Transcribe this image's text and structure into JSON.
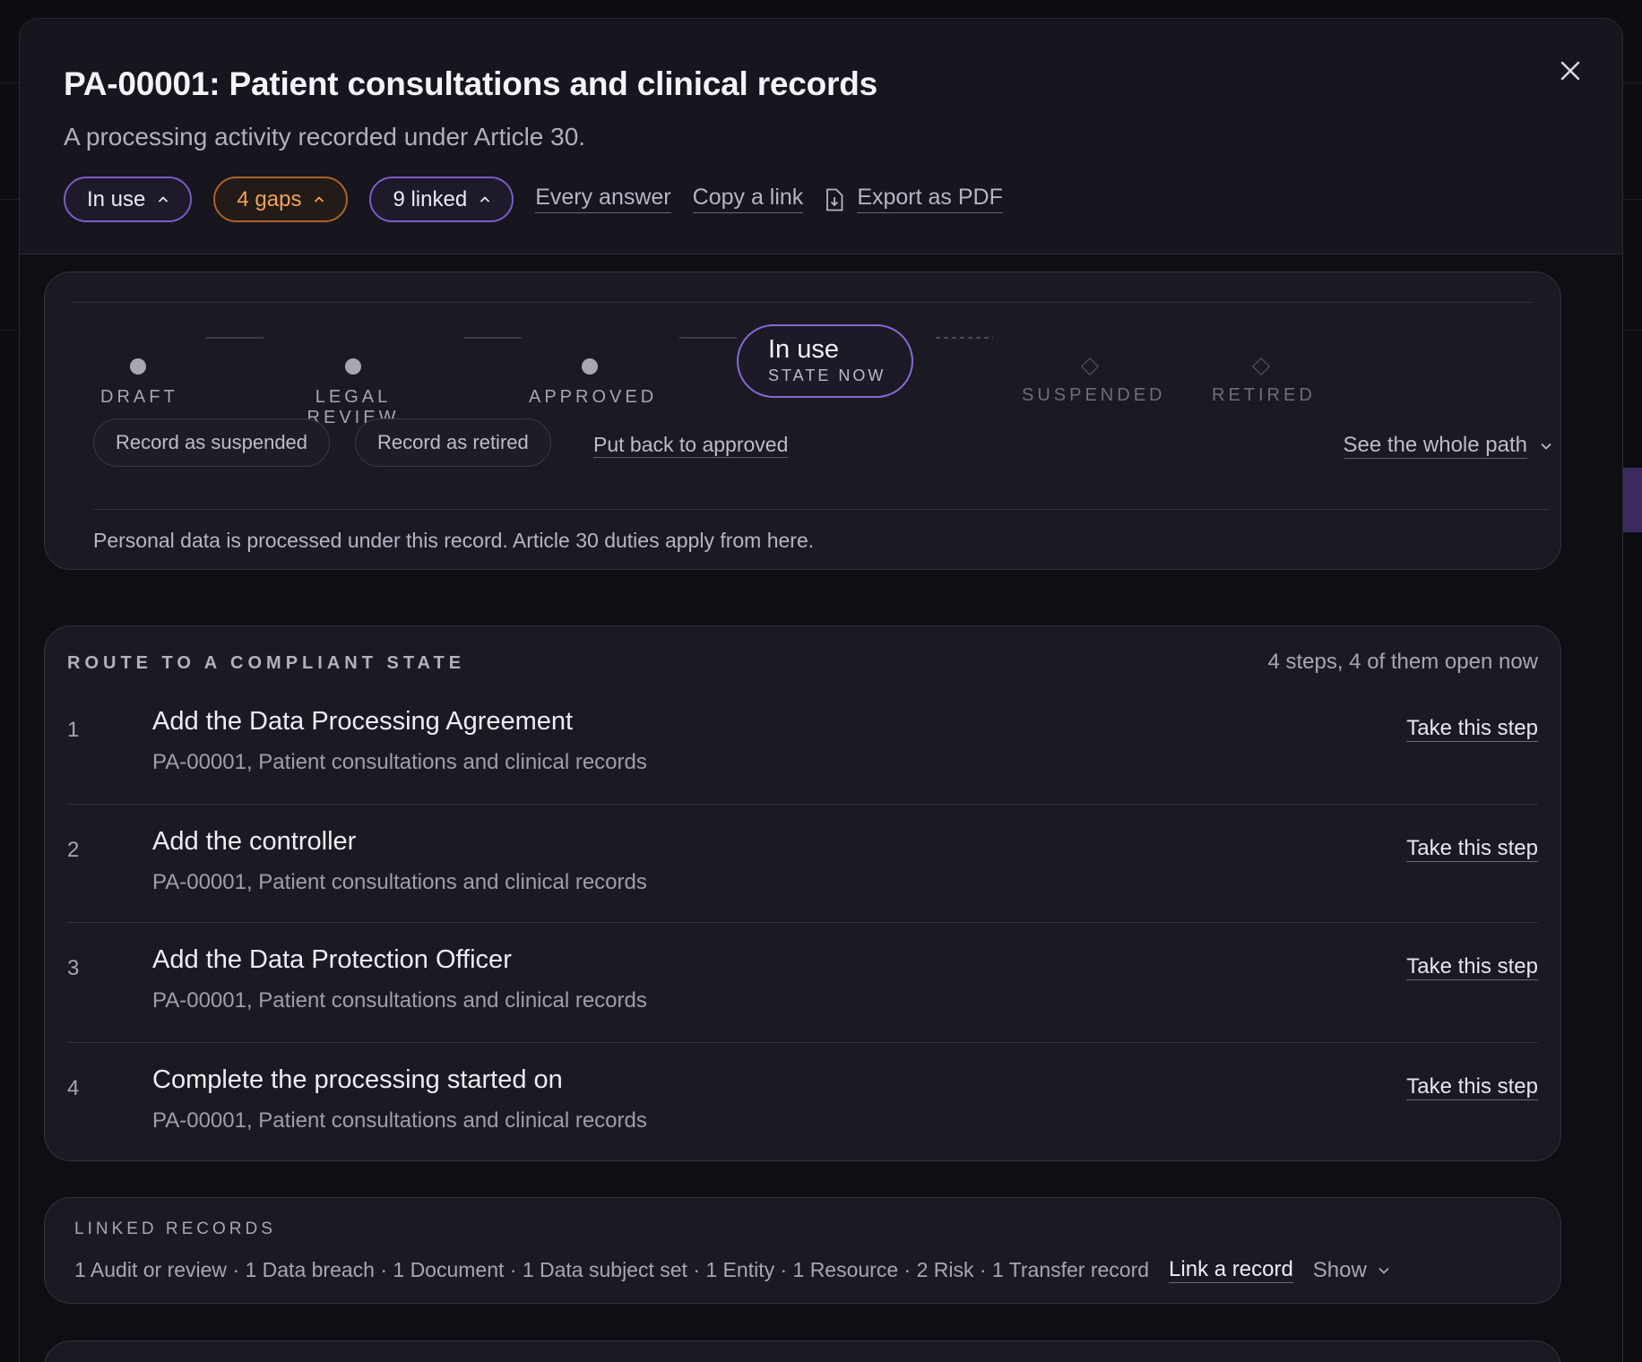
{
  "modal": {
    "title": "PA-00001: Patient consultations and clinical records",
    "subtitle": "A processing activity recorded under Article 30.",
    "close_icon": "close-icon",
    "chips": [
      {
        "label": "In use",
        "color": "#7b5cc6"
      },
      {
        "label": "4 gaps",
        "color": "#f2a25a"
      },
      {
        "label": "9 linked",
        "color": "#7b5cc6"
      }
    ],
    "links": {
      "every_answer": "Every answer",
      "copy_link": "Copy a link",
      "export_pdf": "Export as PDF"
    }
  },
  "lifecycle": {
    "stages": [
      {
        "label": "DRAFT",
        "state": "done"
      },
      {
        "label": "LEGAL REVIEW",
        "state": "done"
      },
      {
        "label": "APPROVED",
        "state": "done"
      },
      {
        "label": "SUSPENDED",
        "state": "future"
      },
      {
        "label": "RETIRED",
        "state": "future"
      }
    ],
    "current": {
      "label": "In use",
      "caption": "STATE NOW"
    },
    "actions": {
      "suspend": "Record as suspended",
      "retire": "Record as retired",
      "back": "Put back to approved",
      "see_path": "See the whole path"
    },
    "note": "Personal data is processed under this record. Article 30 duties apply from here."
  },
  "route": {
    "heading": "ROUTE TO A COMPLIANT STATE",
    "count": "4 steps, 4 of them open now",
    "steps": [
      {
        "num": "1",
        "title": "Add the Data Processing Agreement",
        "sub": "PA-00001, Patient consultations and clinical records",
        "action": "Take this step"
      },
      {
        "num": "2",
        "title": "Add the controller",
        "sub": "PA-00001, Patient consultations and clinical records",
        "action": "Take this step"
      },
      {
        "num": "3",
        "title": "Add the Data Protection Officer",
        "sub": "PA-00001, Patient consultations and clinical records",
        "action": "Take this step"
      },
      {
        "num": "4",
        "title": "Complete the processing started on",
        "sub": "PA-00001, Patient consultations and clinical records",
        "action": "Take this step"
      }
    ]
  },
  "linked": {
    "heading": "LINKED RECORDS",
    "summary": "1 Audit or review · 1 Data breach · 1 Document · 1 Data subject set · 1 Entity · 1 Resource · 2 Risk · 1 Transfer record",
    "link_label": "Link a record",
    "show_label": "Show"
  }
}
